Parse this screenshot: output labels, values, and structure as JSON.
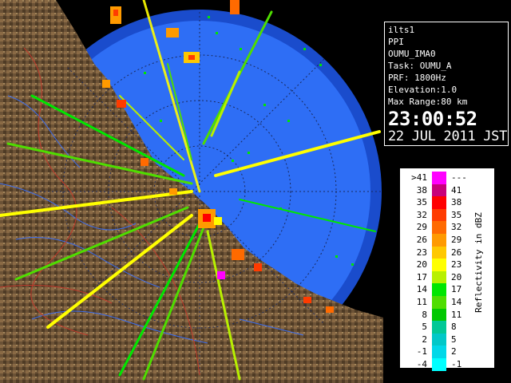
{
  "info": {
    "site": "ilts1",
    "product": "PPI",
    "station": "OUMU_IMA0",
    "task": "Task: OUMU_A",
    "prf": "PRF: 1800Hz",
    "elevation": "Elevation:1.0",
    "max_range": "Max Range:80 km",
    "time": "23:00:52",
    "date": "22 JUL 2011 JST"
  },
  "legend": {
    "unit_label": "Reflectivity in dBZ",
    "rows": [
      {
        "low": ">41",
        "high": "---",
        "color": "#ff00ff"
      },
      {
        "low": "38",
        "high": "41",
        "color": "#c8007a"
      },
      {
        "low": "35",
        "high": "38",
        "color": "#ff0000"
      },
      {
        "low": "32",
        "high": "35",
        "color": "#ff3b00"
      },
      {
        "low": "29",
        "high": "32",
        "color": "#ff6a00"
      },
      {
        "low": "26",
        "high": "29",
        "color": "#ff9a00"
      },
      {
        "low": "23",
        "high": "26",
        "color": "#ffc800"
      },
      {
        "low": "20",
        "high": "23",
        "color": "#ffff00"
      },
      {
        "low": "17",
        "high": "20",
        "color": "#b8f000"
      },
      {
        "low": "14",
        "high": "17",
        "color": "#00e600"
      },
      {
        "low": "11",
        "high": "14",
        "color": "#4fdd00"
      },
      {
        "low": "8",
        "high": "11",
        "color": "#00c800"
      },
      {
        "low": "5",
        "high": "8",
        "color": "#00c896"
      },
      {
        "low": "2",
        "high": "5",
        "color": "#00c8c8"
      },
      {
        "low": "-1",
        "high": "2",
        "color": "#00d8e8"
      },
      {
        "low": "-4",
        "high": "-1",
        "color": "#00ffff"
      }
    ]
  },
  "map": {
    "sea_color": "#2e6ef5",
    "outer_sea_color": "#1a4ccc",
    "land_color": "#6b5236",
    "river_color": "#3a6df0",
    "boundary_color": "#c0392b",
    "range_ring_color": "#1a2a5c"
  }
}
